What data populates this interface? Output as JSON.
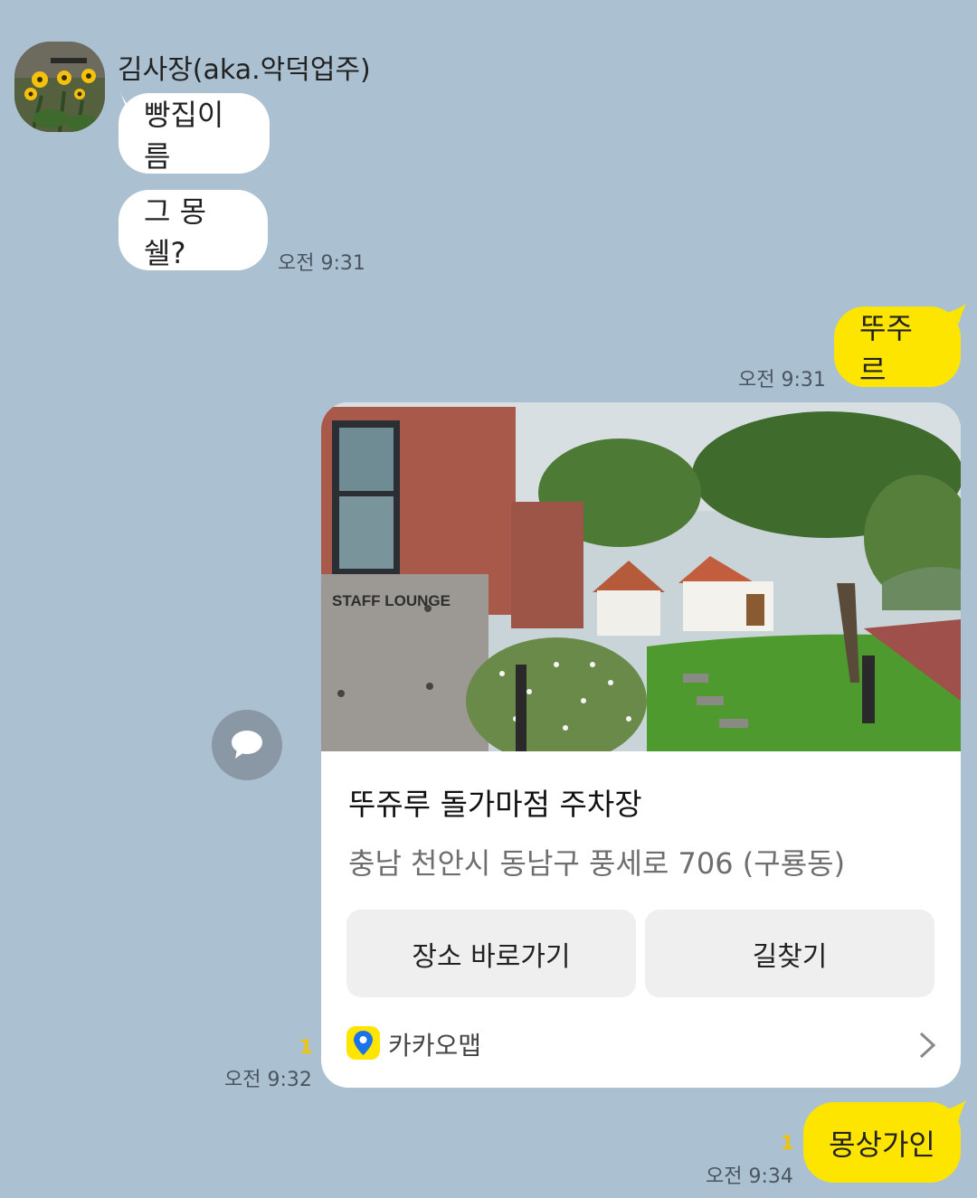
{
  "chat": {
    "sender_name": "김사장(aka.악덕업주)",
    "messages": {
      "in1": "빵집이름",
      "in2": "그 몽쉘?",
      "in_time": "오전 9:31",
      "out1": "뚜주르",
      "out1_time": "오전 9:31",
      "card_time": "오전 9:32",
      "card_unread": "1",
      "out2": "몽상가인",
      "out2_time": "오전 9:34",
      "out2_unread": "1"
    }
  },
  "place_card": {
    "photo_sign_text": "STAFF LOUNGE",
    "title": "뚜쥬루 돌가마점 주차장",
    "address": "충남 천안시 동남구 풍세로 706 (구룡동)",
    "button_place": "장소 바로가기",
    "button_directions": "길찾기",
    "provider": "카카오맵",
    "provider_icon": "map-pin-icon"
  },
  "colors": {
    "background": "#abc1d1",
    "outgoing_bubble": "#fee500",
    "incoming_bubble": "#ffffff",
    "unread": "#f2c200"
  }
}
